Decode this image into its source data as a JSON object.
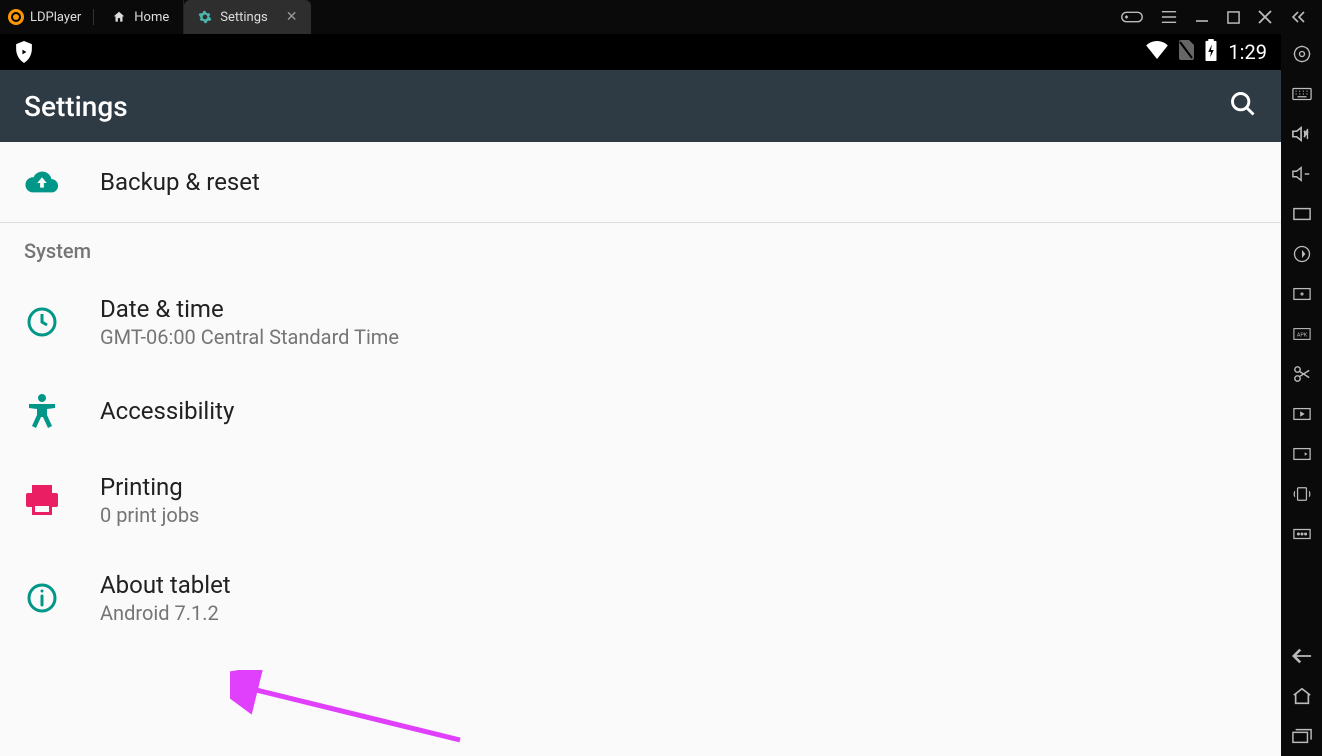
{
  "titlebar": {
    "brand": "LDPlayer",
    "tabs": [
      {
        "label": "Home",
        "active": false
      },
      {
        "label": "Settings",
        "active": true
      }
    ]
  },
  "statusbar": {
    "time": "1:29"
  },
  "appbar": {
    "title": "Settings"
  },
  "settings": {
    "backup": {
      "title": "Backup & reset"
    },
    "section_system": "System",
    "datetime": {
      "title": "Date & time",
      "subtitle": "GMT-06:00 Central Standard Time"
    },
    "accessibility": {
      "title": "Accessibility"
    },
    "printing": {
      "title": "Printing",
      "subtitle": "0 print jobs"
    },
    "about": {
      "title": "About tablet",
      "subtitle": "Android 7.1.2"
    }
  },
  "colors": {
    "accent_teal": "#009688",
    "accent_magenta": "#e91e63",
    "appbar_bg": "#2f3b44"
  }
}
